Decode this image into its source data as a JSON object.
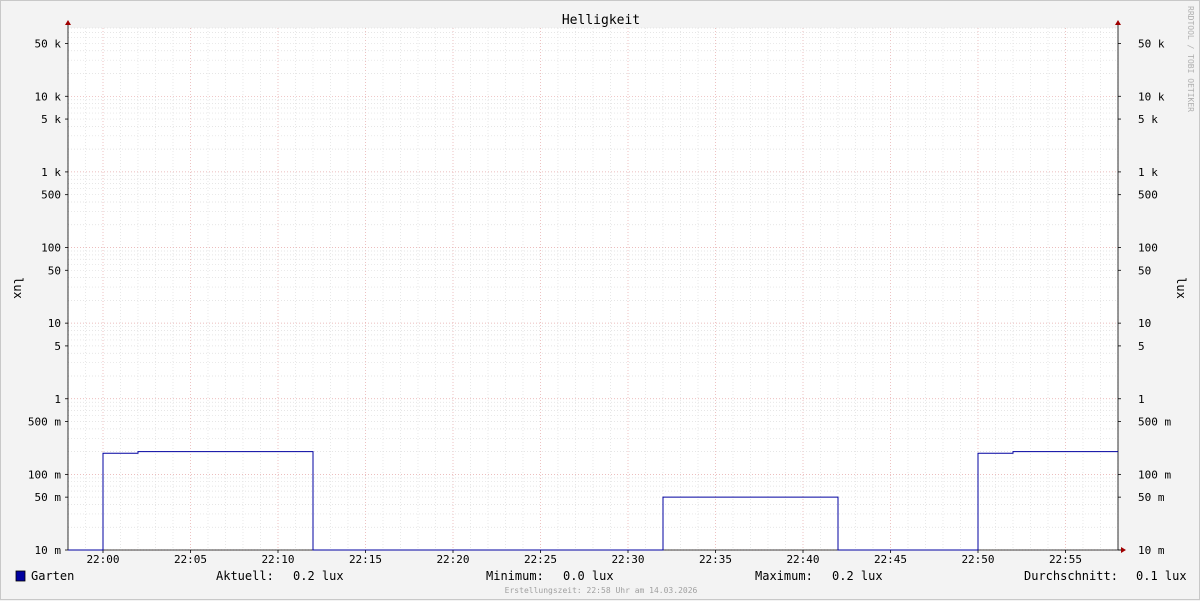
{
  "chart_data": {
    "type": "line",
    "title": "Helligkeit",
    "ylabel": "lux",
    "y_scale": "log",
    "ylim": [
      0.01,
      80000
    ],
    "xlim": [
      "21:58",
      "22:58"
    ],
    "x_ticks": [
      "22:00",
      "22:05",
      "22:10",
      "22:15",
      "22:20",
      "22:25",
      "22:30",
      "22:35",
      "22:40",
      "22:45",
      "22:50",
      "22:55"
    ],
    "y_ticks": [
      {
        "value": 0.01,
        "label": "10 m"
      },
      {
        "value": 0.05,
        "label": "50 m"
      },
      {
        "value": 0.1,
        "label": "100 m"
      },
      {
        "value": 0.5,
        "label": "500 m"
      },
      {
        "value": 1,
        "label": "1"
      },
      {
        "value": 5,
        "label": "5"
      },
      {
        "value": 10,
        "label": "10"
      },
      {
        "value": 50,
        "label": "50"
      },
      {
        "value": 100,
        "label": "100"
      },
      {
        "value": 500,
        "label": "500"
      },
      {
        "value": 1000,
        "label": "1 k"
      },
      {
        "value": 5000,
        "label": "5 k"
      },
      {
        "value": 10000,
        "label": "10 k"
      },
      {
        "value": 50000,
        "label": "50 k"
      }
    ],
    "grid": true,
    "legend_position": "bottom-left",
    "series": [
      {
        "name": "Garten",
        "color": "#0000a0",
        "step": true,
        "points": [
          [
            "21:58",
            0.01
          ],
          [
            "22:00",
            0.01
          ],
          [
            "22:00",
            0.19
          ],
          [
            "22:02",
            0.19
          ],
          [
            "22:02",
            0.2
          ],
          [
            "22:12",
            0.2
          ],
          [
            "22:12",
            0.01
          ],
          [
            "22:32",
            0.01
          ],
          [
            "22:32",
            0.05
          ],
          [
            "22:42",
            0.05
          ],
          [
            "22:42",
            0.01
          ],
          [
            "22:50",
            0.01
          ],
          [
            "22:50",
            0.19
          ],
          [
            "22:52",
            0.19
          ],
          [
            "22:52",
            0.2
          ],
          [
            "22:58",
            0.2
          ]
        ]
      }
    ]
  },
  "watermark": "RRDTOOL / TOBI OETIKER",
  "legend": {
    "series_name": "Garten",
    "color": "#0000a0",
    "current_label": "Aktuell:",
    "current_value": "0.2 lux",
    "min_label": "Minimum:",
    "min_value": "0.0 lux",
    "max_label": "Maximum:",
    "max_value": "0.2 lux",
    "avg_label": "Durchschnitt:",
    "avg_value": "0.1 lux"
  },
  "footer": "Erstellungszeit: 22:58 Uhr am 14.03.2026"
}
